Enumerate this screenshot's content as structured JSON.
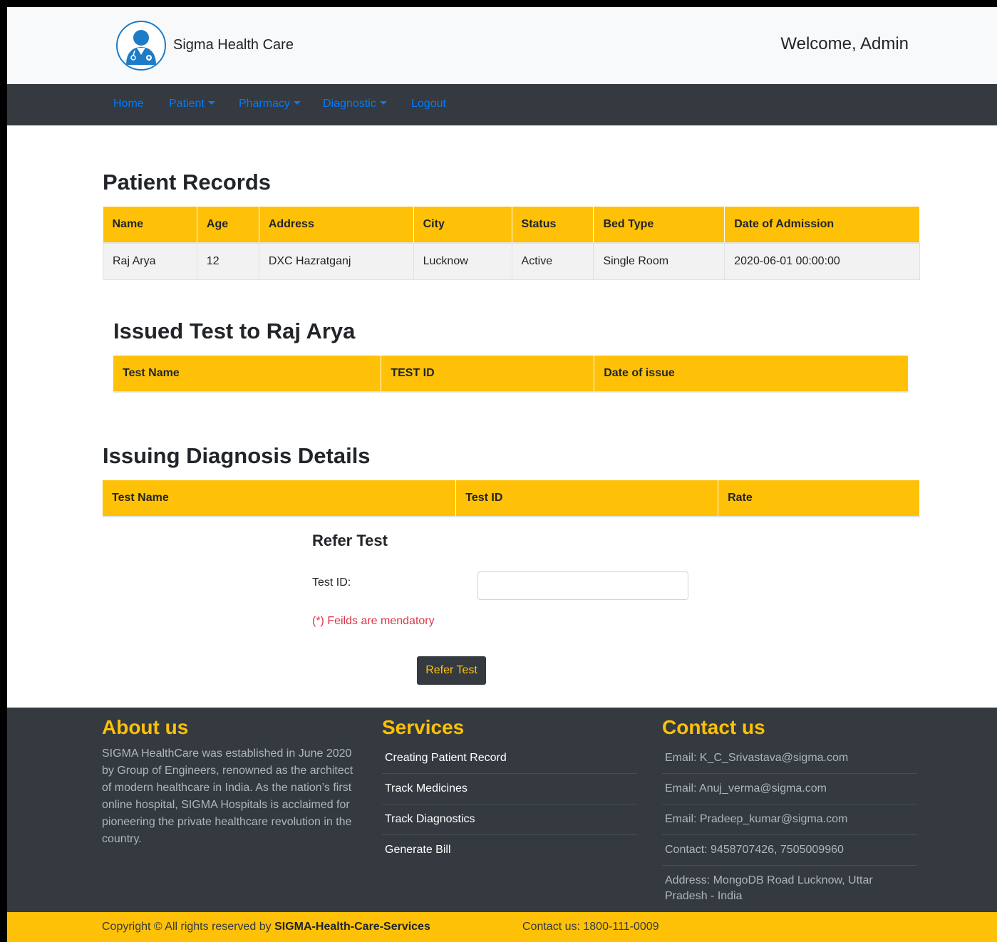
{
  "header": {
    "brand": "Sigma Health Care",
    "welcome": "Welcome, Admin"
  },
  "nav": {
    "home": "Home",
    "patient": "Patient",
    "pharmacy": "Pharmacy",
    "diagnostic": "Diagnostic",
    "logout": "Logout"
  },
  "patient_records": {
    "title": "Patient Records",
    "columns": [
      "Name",
      "Age",
      "Address",
      "City",
      "Status",
      "Bed Type",
      "Date of Admission"
    ],
    "rows": [
      [
        "Raj Arya",
        "12",
        "DXC Hazratganj",
        "Lucknow",
        "Active",
        "Single Room",
        "2020-06-01 00:00:00"
      ]
    ]
  },
  "issued_tests": {
    "title": "Issued Test to Raj Arya",
    "columns": [
      "Test Name",
      "TEST ID",
      "Date of issue"
    ]
  },
  "diagnosis_details": {
    "title": "Issuing Diagnosis Details",
    "columns": [
      "Test Name",
      "Test ID",
      "Rate"
    ]
  },
  "refer_form": {
    "title": "Refer Test",
    "test_id_label": "Test ID:",
    "test_id_value": "",
    "mandatory_note": "(*) Feilds are mendatory",
    "submit_label": "Refer Test"
  },
  "footer": {
    "about_title": "About us",
    "about_text": "SIGMA HealthCare was established in June 2020 by Group of Engineers, renowned as the architect of modern healthcare in India. As the nation’s first online hospital, SIGMA Hospitals is acclaimed for pioneering the private healthcare revolution in the country.",
    "services_title": "Services",
    "services": [
      "Creating Patient Record",
      "Track Medicines",
      "Track Diagnostics",
      "Generate Bill"
    ],
    "contact_title": "Contact us",
    "contacts": [
      "Email: K_C_Srivastava@sigma.com",
      "Email: Anuj_verma@sigma.com",
      "Email: Pradeep_kumar@sigma.com",
      "Contact: 9458707426, 7505009960",
      "Address: MongoDB Road Lucknow, Uttar Pradesh - India"
    ],
    "copyright_prefix": "Copyright © All rights reserved by ",
    "copyright_owner": "SIGMA-Health-Care-Services",
    "contact_line": "Contact us: 1800-111-0009"
  },
  "colors": {
    "accent": "#ffc107",
    "dark": "#343a40",
    "link": "#007bff",
    "danger": "#dc3545"
  }
}
